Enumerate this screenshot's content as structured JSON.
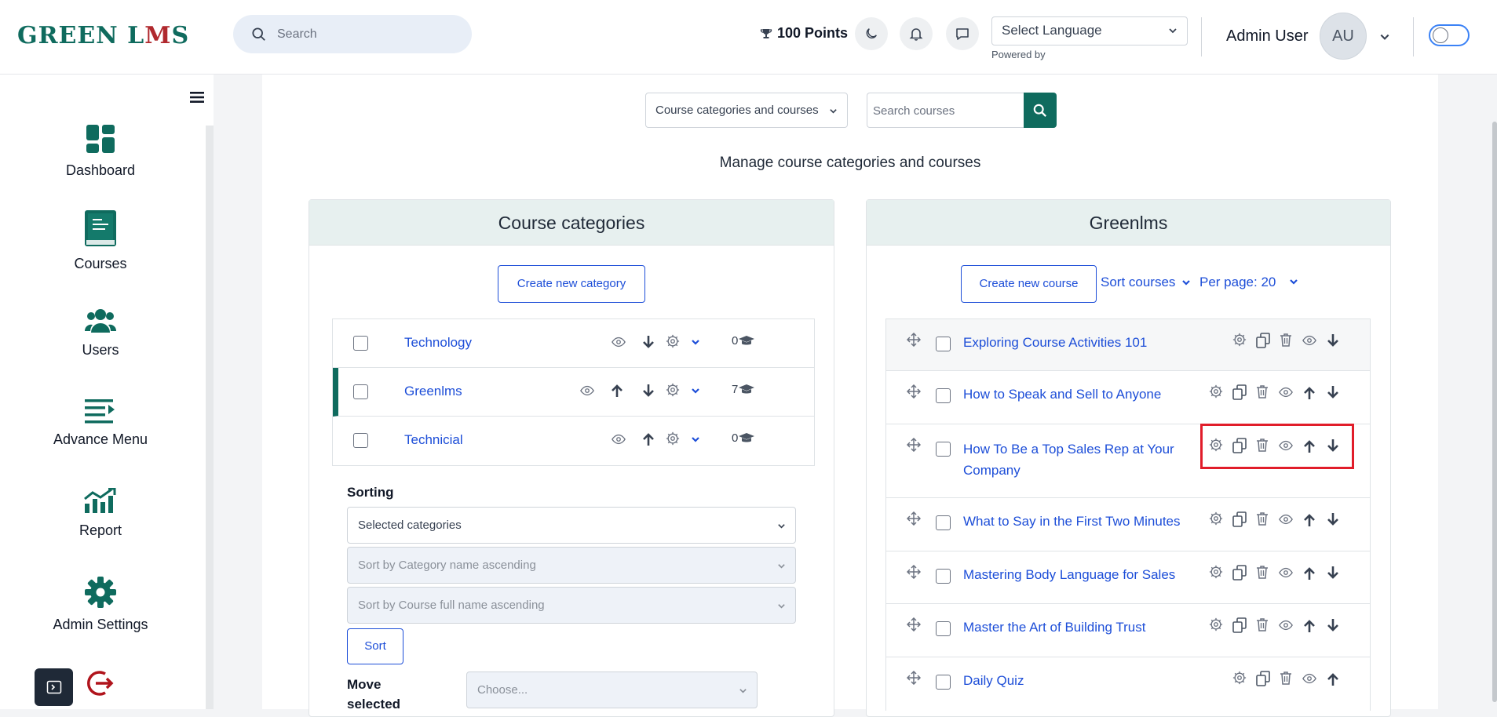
{
  "header": {
    "logo_green": "GREEN L",
    "logo_m": "M",
    "logo_s": "S",
    "search_placeholder": "Search",
    "points": "100 Points",
    "language": "Select Language",
    "powered_by": "Powered by",
    "user_name": "Admin User",
    "avatar_initials": "AU"
  },
  "sidebar": {
    "items": [
      {
        "label": "Dashboard",
        "icon": "dashboard-icon"
      },
      {
        "label": "Courses",
        "icon": "book-icon"
      },
      {
        "label": "Users",
        "icon": "users-icon"
      },
      {
        "label": "Advance Menu",
        "icon": "menu-icon"
      },
      {
        "label": "Report",
        "icon": "chart-icon"
      },
      {
        "label": "Admin Settings",
        "icon": "gear-icon"
      }
    ]
  },
  "toolbar": {
    "view_select": "Course categories and courses",
    "search_courses_placeholder": "Search courses"
  },
  "page_title": "Manage course categories and courses",
  "categories_panel": {
    "title": "Course categories",
    "create_button": "Create new category",
    "rows": [
      {
        "name": "Technology",
        "count": "0"
      },
      {
        "name": "Greenlms",
        "count": "7"
      },
      {
        "name": "Technicial",
        "count": "0"
      }
    ],
    "sorting_label": "Sorting",
    "sort_scope": "Selected categories",
    "sort_categories": "Sort by Category name ascending",
    "sort_courses": "Sort by Course full name ascending",
    "sort_button": "Sort",
    "move_selected_label": "Move selected",
    "choose_placeholder": "Choose..."
  },
  "courses_panel": {
    "title": "Greenlms",
    "create_button": "Create new course",
    "sort_courses": "Sort courses",
    "per_page": "Per page: 20",
    "rows": [
      {
        "name": "Exploring Course Activities 101"
      },
      {
        "name": "How to Speak and Sell to Anyone"
      },
      {
        "name": "How To Be a Top Sales Rep at Your Company"
      },
      {
        "name": "What to Say in the First Two Minutes"
      },
      {
        "name": "Mastering Body Language for Sales"
      },
      {
        "name": "Master the Art of Building Trust"
      },
      {
        "name": "Daily Quiz"
      }
    ]
  },
  "colors": {
    "brand": "#0f6b5e",
    "link": "#1d4ed8",
    "highlight": "#e11d2a"
  }
}
